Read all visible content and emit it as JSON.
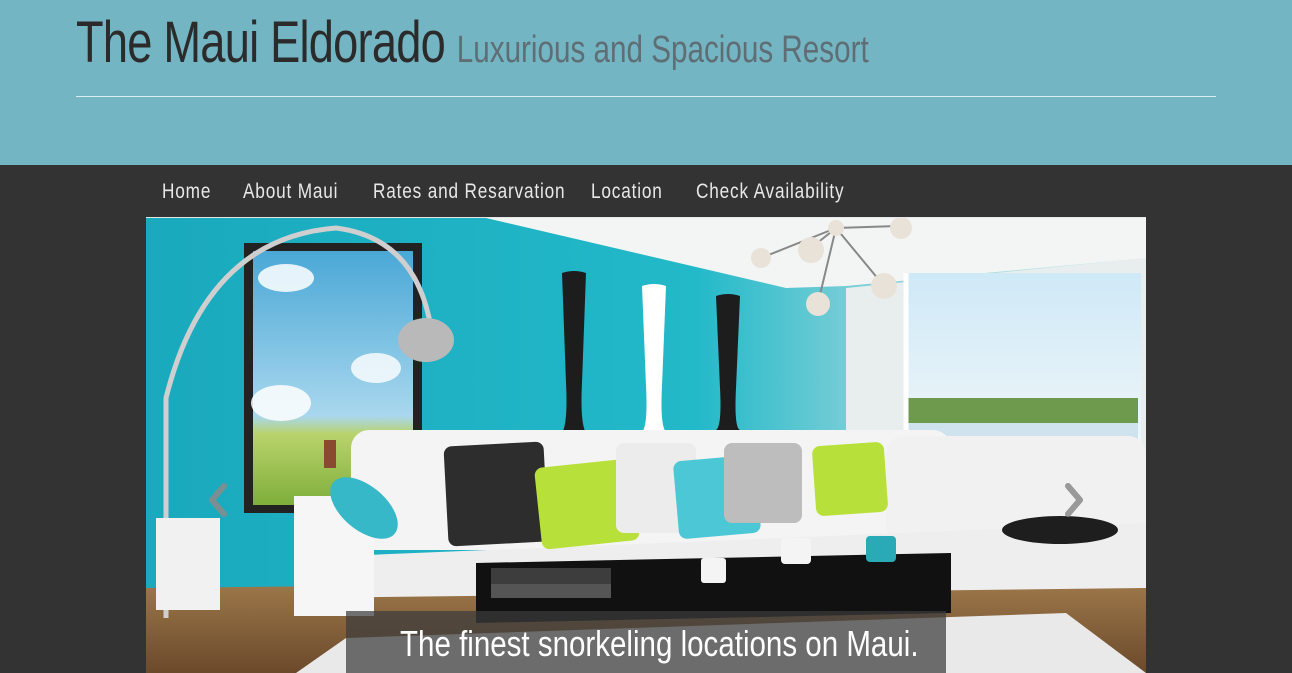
{
  "site": {
    "title": "The Maui Eldorado",
    "tagline": "Luxurious and Spacious Resort"
  },
  "nav": {
    "items": [
      {
        "label": "Home"
      },
      {
        "label": "About Maui"
      },
      {
        "label": "Rates and Resarvation"
      },
      {
        "label": "Location"
      },
      {
        "label": "Check Availability"
      }
    ]
  },
  "carousel": {
    "caption": "The finest snorkeling locations on Maui.",
    "prev_icon": "chevron-left-icon",
    "next_icon": "chevron-right-icon"
  },
  "colors": {
    "header_bg": "#74b5c3",
    "page_bg": "#333333",
    "wall_accent": "#1fb3c4",
    "pillow_lime": "#b8e03a"
  }
}
